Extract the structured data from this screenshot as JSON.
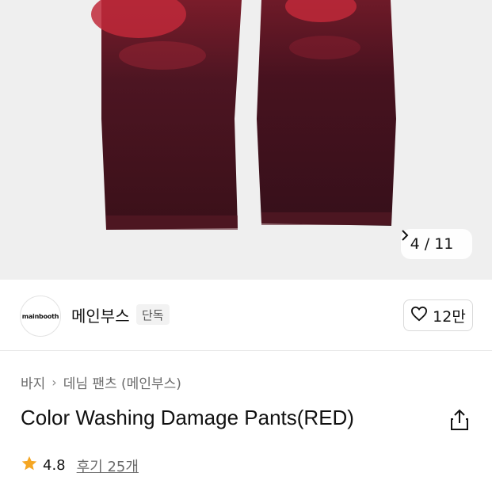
{
  "gallery": {
    "current": "4",
    "separator": "/",
    "total": "11",
    "next_icon": "chevron-right-icon"
  },
  "brand": {
    "logo_text": "mainbooth",
    "name": "메인부스",
    "badge": "단독",
    "like_count": "12만",
    "like_icon": "heart-icon"
  },
  "product": {
    "breadcrumb": [
      "바지",
      "데님 팬츠 (메인부스)"
    ],
    "title": "Color Washing Damage Pants(RED)",
    "rating": "4.8",
    "reviews": "후기 25개",
    "star_color": "#f5a623"
  }
}
